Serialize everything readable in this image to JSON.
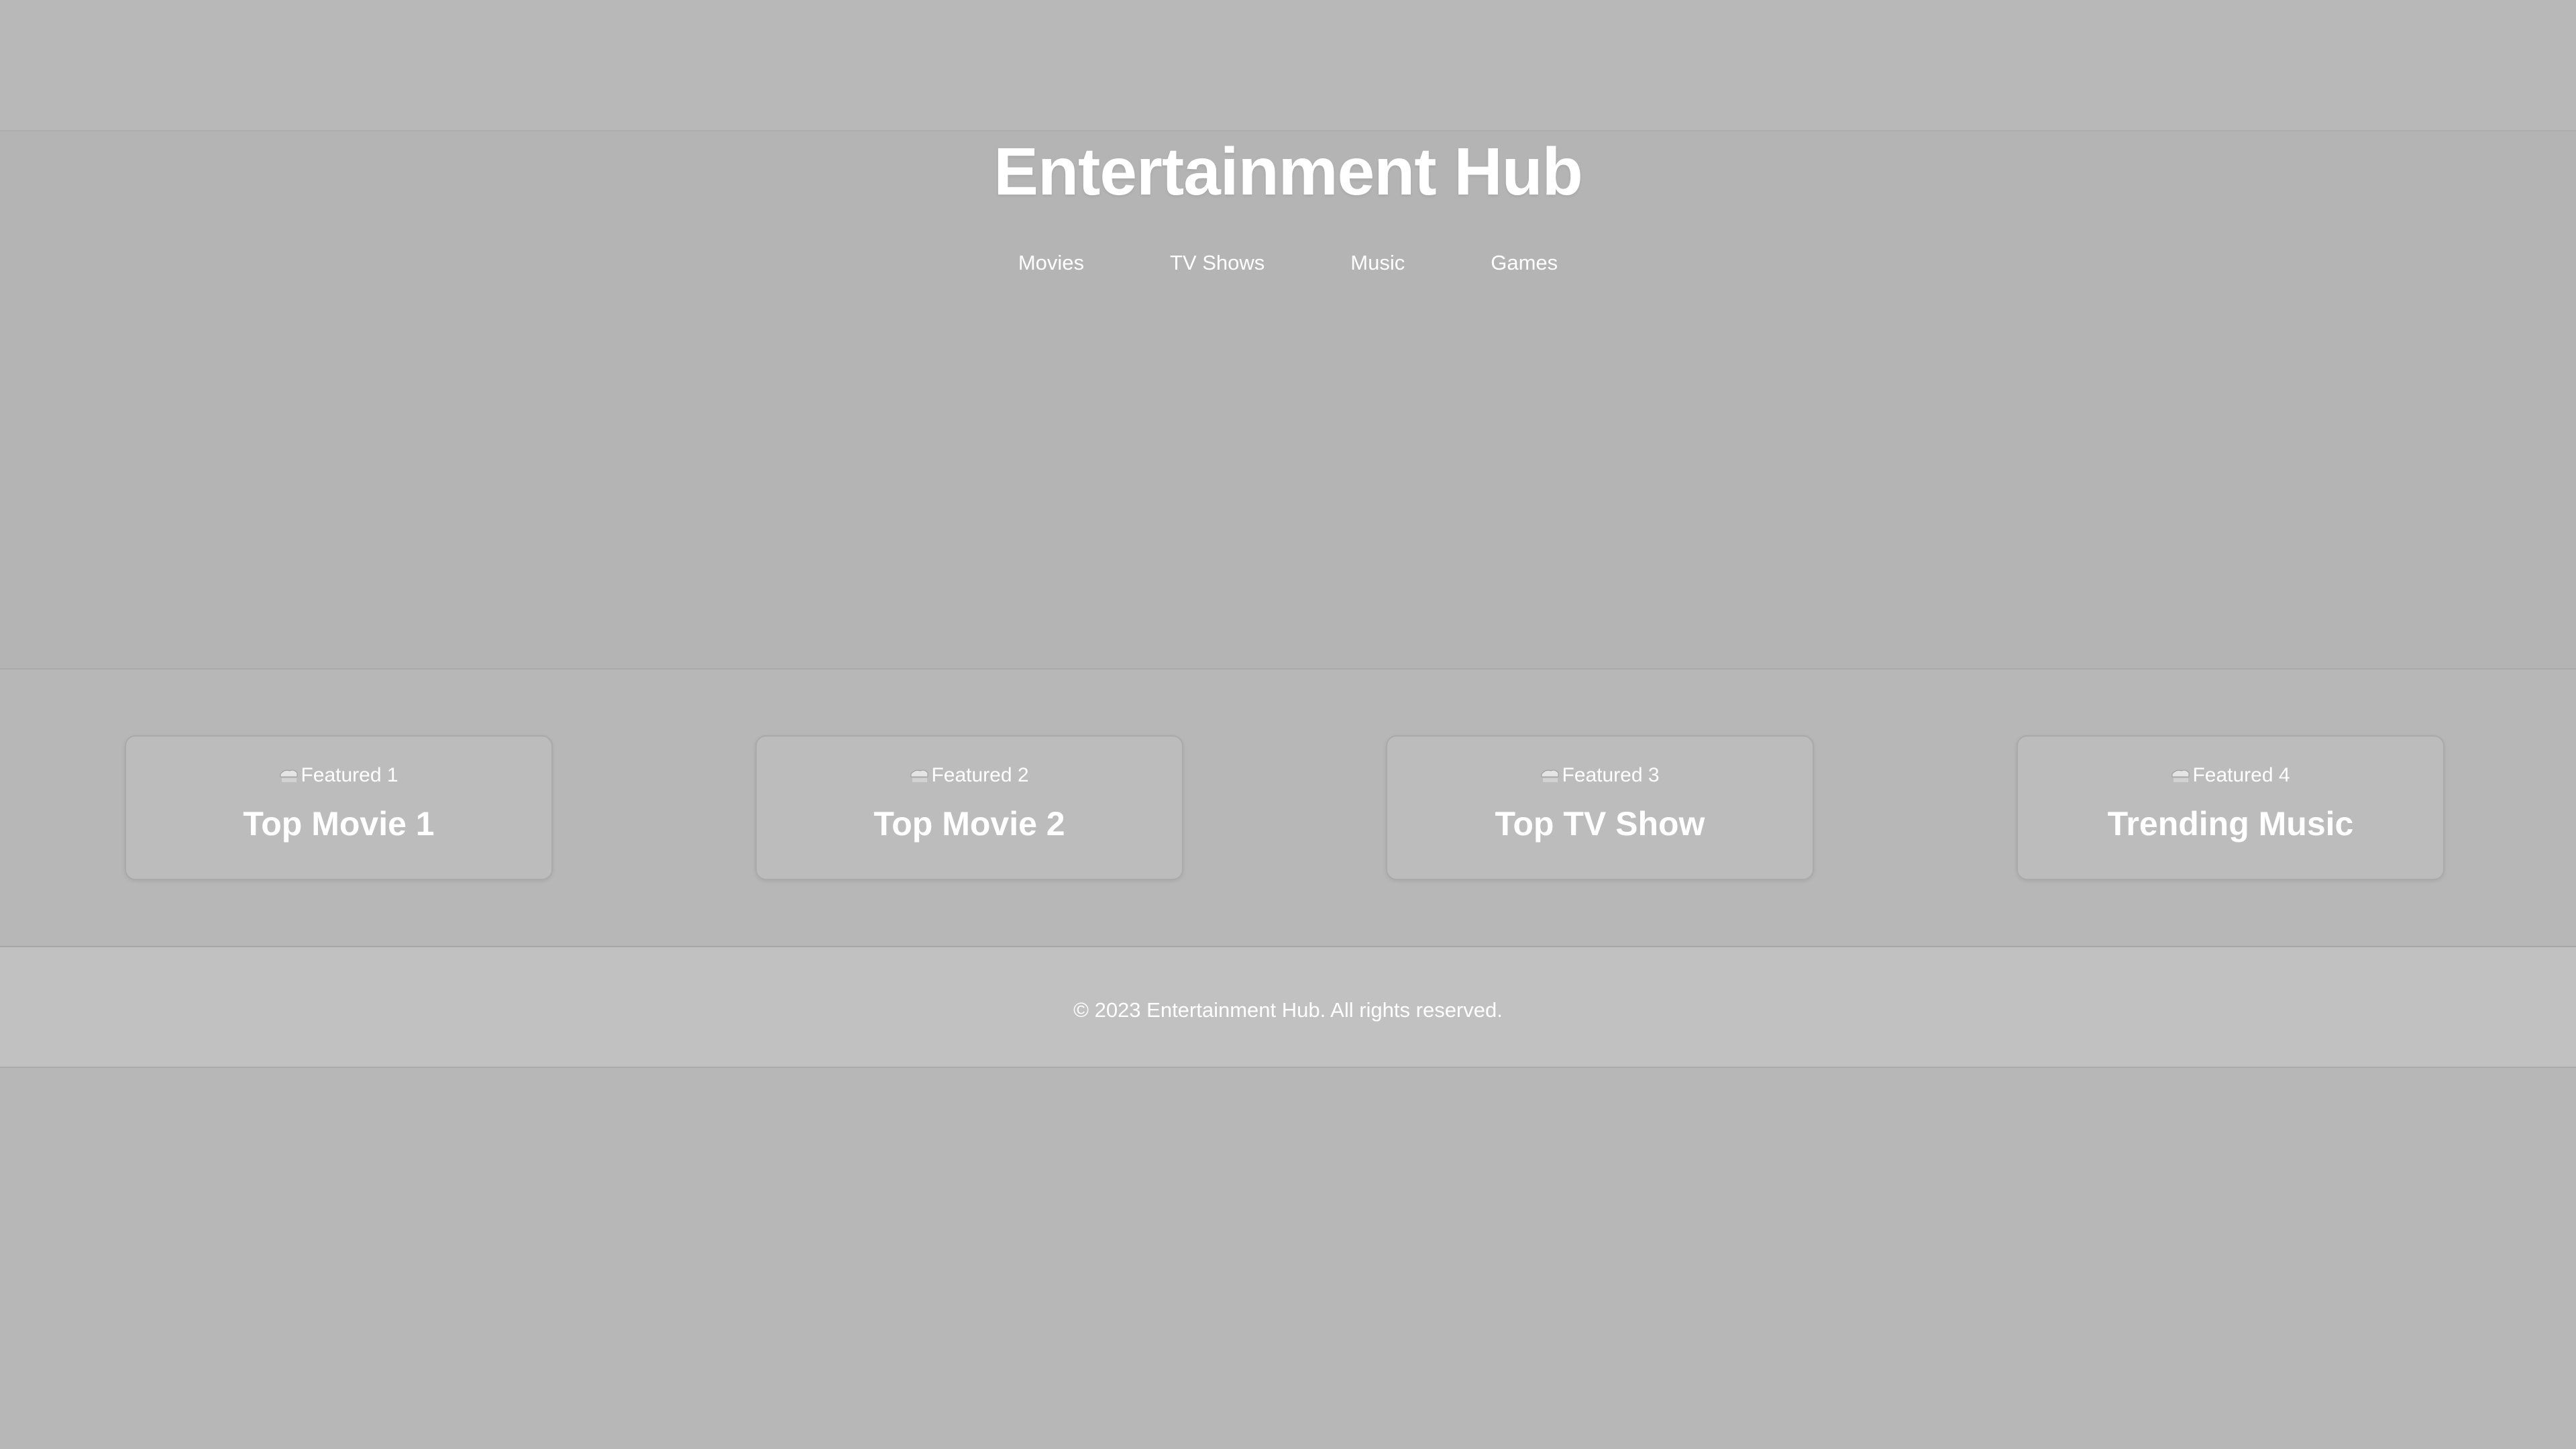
{
  "header": {
    "title": "Entertainment Hub",
    "nav": [
      {
        "label": "Movies"
      },
      {
        "label": "TV Shows"
      },
      {
        "label": "Music"
      },
      {
        "label": "Games"
      }
    ]
  },
  "featured": {
    "cards": [
      {
        "image_alt": "Featured 1",
        "title": "Top Movie 1"
      },
      {
        "image_alt": "Featured 2",
        "title": "Top Movie 2"
      },
      {
        "image_alt": "Featured 3",
        "title": "Top TV Show"
      },
      {
        "image_alt": "Featured 4",
        "title": "Trending Music"
      }
    ]
  },
  "footer": {
    "text": "© 2023 Entertainment Hub. All rights reserved."
  },
  "colors": {
    "background": "#b7b7b7",
    "text": "#ffffff",
    "card_background": "#bcbcbc",
    "footer_background": "#c1c1c1"
  },
  "icons": {
    "broken_image": "broken-image-icon"
  }
}
